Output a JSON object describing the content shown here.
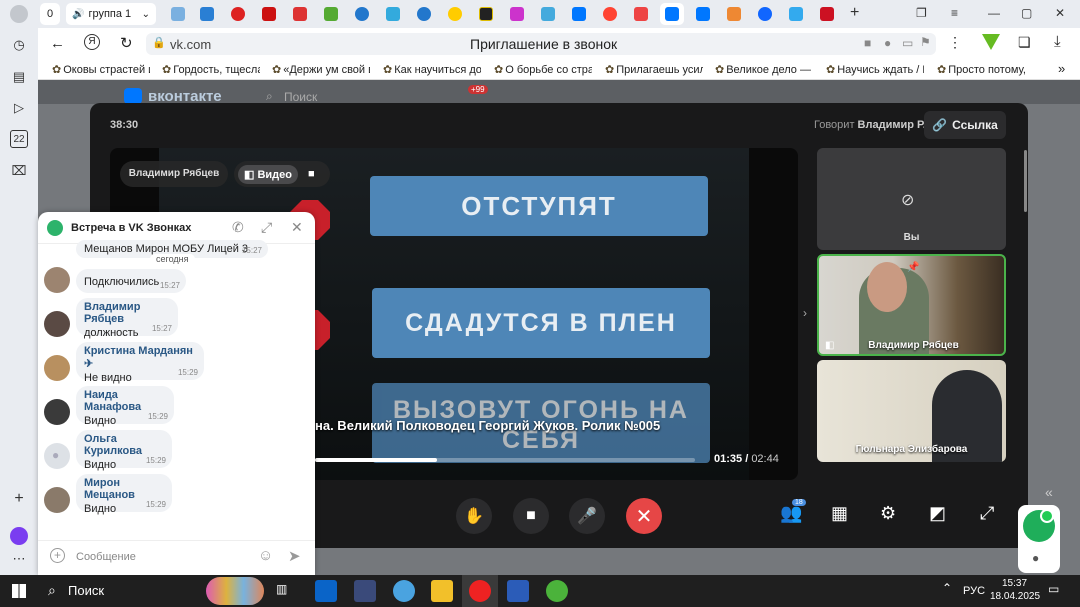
{
  "tabs": {
    "count": "0",
    "active_label": "группа 1"
  },
  "address": {
    "domain": "vk.com",
    "page_title": "Приглашение в звонок"
  },
  "bookmarks": [
    "Оковы страстей и",
    "Гордость, тщесла",
    "«Держи ум свой в",
    "Как научиться до",
    "О борьбе со стра",
    "Прилагаешь усил",
    "Великое дело — у",
    "Научись ждать / П",
    "Просто потому,"
  ],
  "vk": {
    "logo": "вконтакте",
    "search_placeholder": "Поиск",
    "notif_badge": "+99"
  },
  "call": {
    "timer": "38:30",
    "speaking_prefix": "Говорит",
    "speaking_name": "Владимир Р.",
    "link_label": "Ссылка",
    "presenter_name": "Владимир Рябцев",
    "video_label": "Видео",
    "banners": [
      "ОТСТУПЯТ",
      "СДАДУТСЯ В ПЛЕН",
      "ВЫЗОВУТ ОГОНЬ НА СЕБЯ"
    ],
    "subtitle": "на. Великий Полководец Георгий Жуков. Ролик №005",
    "time_current": "01:35",
    "time_total": "02:44",
    "progress": 0.32,
    "participants_badge": "18",
    "tiles": [
      {
        "name": "Вы"
      },
      {
        "name": "Владимир Рябцев"
      },
      {
        "name": "Гюльнара Элизбарова"
      }
    ]
  },
  "chat": {
    "title": "Встреча в VK Звонках",
    "truncated_msg": "Мещанов Мирон МОБУ Лицей 3",
    "truncated_time": "15:27",
    "date_divider": "сегодня",
    "messages": [
      {
        "name": "",
        "text": "Подключились",
        "time": "15:27"
      },
      {
        "name": "Владимир Рябцев",
        "text": "должность",
        "time": "15:27"
      },
      {
        "name": "Кристина Марданян ✈",
        "text": "Не видно",
        "time": "15:29"
      },
      {
        "name": "Наида Манафова",
        "text": "Видно",
        "time": "15:29"
      },
      {
        "name": "Ольга Курилкова",
        "text": "Видно",
        "time": "15:29"
      },
      {
        "name": "Мирон Мещанов",
        "text": "Видно",
        "time": "15:29"
      }
    ],
    "input_placeholder": "Сообщение"
  },
  "taskbar": {
    "search_label": "Поиск",
    "lang": "РУС",
    "time": "15:37",
    "date": "18.04.2025"
  }
}
